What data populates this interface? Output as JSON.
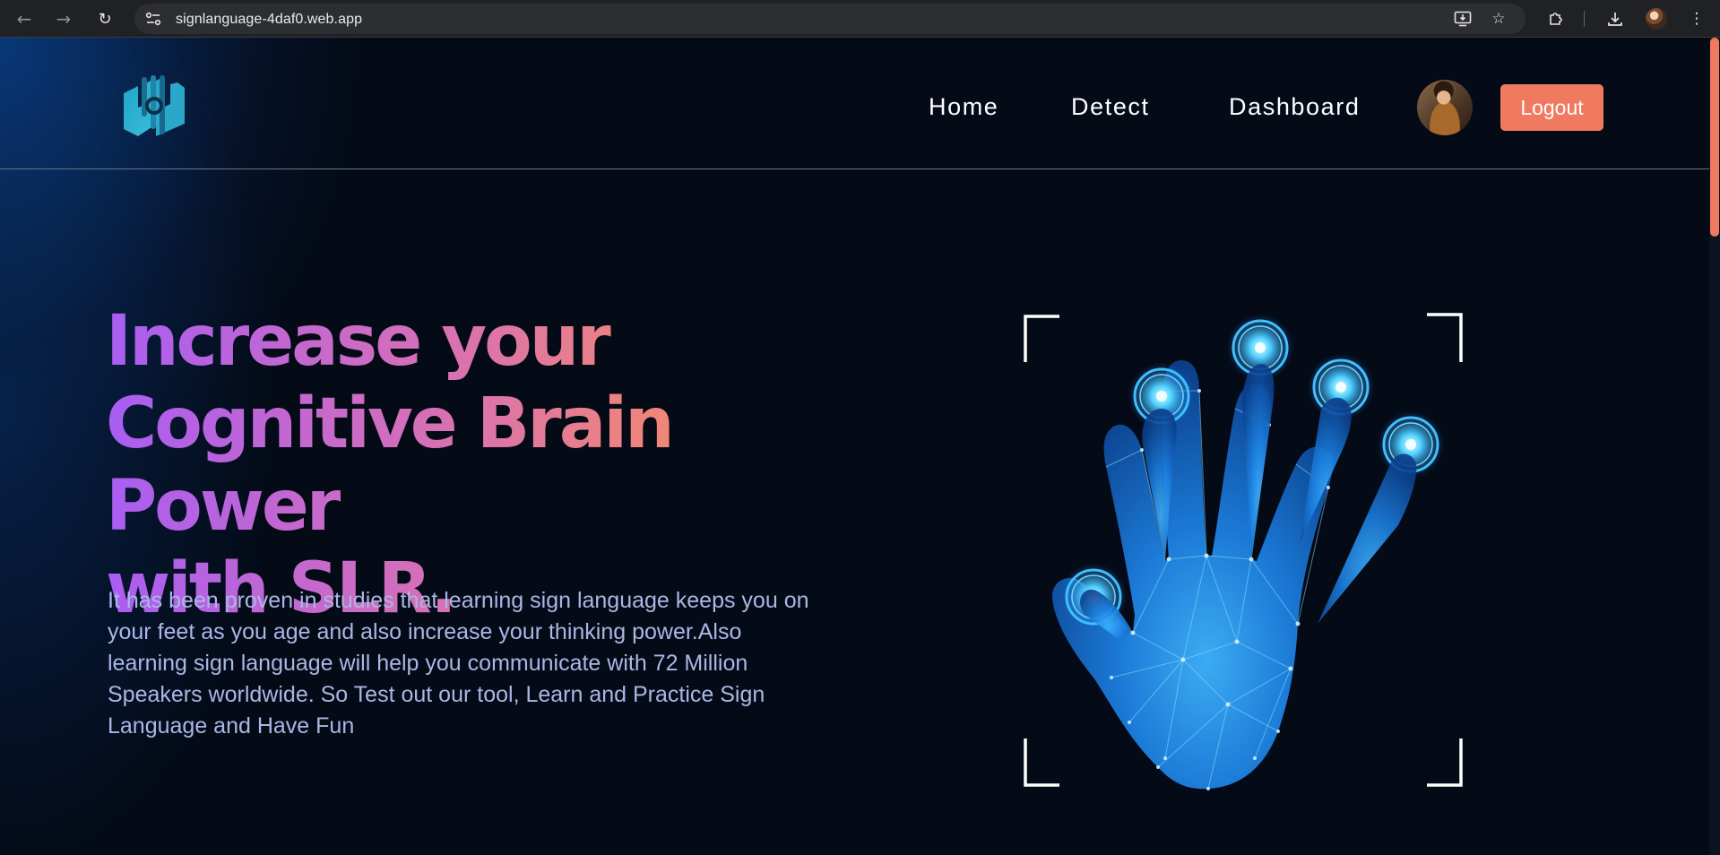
{
  "browser": {
    "url": "signlanguage-4daf0.web.app",
    "icons": [
      "back-arrow-icon",
      "forward-arrow-icon",
      "reload-icon",
      "site-info-icon",
      "install-app-icon",
      "bookmark-star-icon",
      "extensions-puzzle-icon",
      "download-icon",
      "profile-avatar-icon",
      "kebab-menu-icon"
    ]
  },
  "nav": {
    "links": [
      "Home",
      "Detect",
      "Dashboard"
    ],
    "logout_label": "Logout"
  },
  "hero": {
    "headline_lines": [
      "Increase your",
      "Cognitive Brain Power",
      "with SLR."
    ],
    "description": "It has been proven in studies that learning sign language keeps you on your feet as you age and also increase your thinking power.Also learning sign language will help you communicate with 72 Million Speakers worldwide. So Test out our tool, Learn and Practice Sign Language and Have Fun"
  },
  "colors": {
    "page_bg": "#040a16",
    "accent": "#f07a5f",
    "gradient_start": "#a95df2",
    "gradient_end": "#f7936b",
    "body_text": "#aab7e6",
    "hand_blue": "#1e8df0"
  }
}
